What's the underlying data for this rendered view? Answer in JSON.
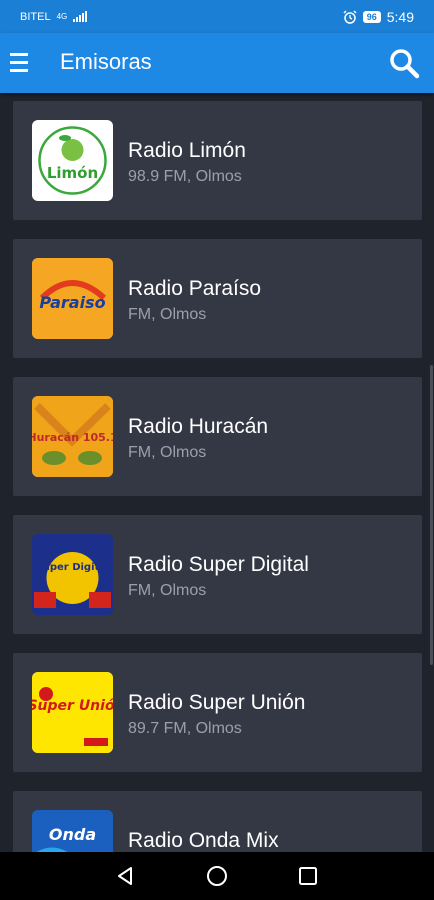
{
  "status_bar": {
    "carrier": "BITEL",
    "network": "4G",
    "battery": "96",
    "time": "5:49"
  },
  "app_bar": {
    "title": "Emisoras"
  },
  "stations": [
    {
      "name": "Radio Limón",
      "info": "98.9 FM, Olmos",
      "logo_text": "Limón",
      "logo_bg": "#ffffff",
      "logo_fg": "#2e9e2e"
    },
    {
      "name": "Radio Paraíso",
      "info": "FM, Olmos",
      "logo_text": "Paraiso",
      "logo_bg": "#f5a623",
      "logo_fg": "#1a3f9c"
    },
    {
      "name": "Radio Huracán",
      "info": "FM, Olmos",
      "logo_text": "Huracán 105.1",
      "logo_bg": "#f0a41a",
      "logo_fg": "#c0282b"
    },
    {
      "name": "Radio Super Digital",
      "info": "FM, Olmos",
      "logo_text": "Super Digital",
      "logo_bg": "#1c2f8a",
      "logo_fg": "#ffe000"
    },
    {
      "name": "Radio Super Unión",
      "info": "89.7 FM, Olmos",
      "logo_text": "Super Unión",
      "logo_bg": "#ffe600",
      "logo_fg": "#d21a1a"
    },
    {
      "name": "Radio Onda Mix",
      "info": "",
      "logo_text": "Onda",
      "logo_bg": "#1b5fbf",
      "logo_fg": "#ffffff"
    }
  ],
  "colors": {
    "app_bar": "#1e88e5",
    "status_bar": "#1b7fd6",
    "background": "#1f232b",
    "card": "#343845"
  }
}
